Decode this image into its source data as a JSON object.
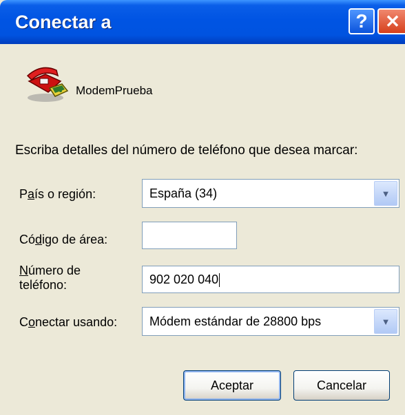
{
  "window": {
    "title": "Conectar a"
  },
  "titlebar_buttons": {
    "help": "?",
    "close": "✕"
  },
  "connection": {
    "name": "ModemPrueba",
    "icon": "phone-modem-icon"
  },
  "instructions": "Escriba detalles del número de teléfono que desea marcar:",
  "fields": {
    "country": {
      "label_prefix": "P",
      "label_accel": "a",
      "label_rest": "ís o región:",
      "value": "España (34)"
    },
    "area_code": {
      "label_prefix": "Có",
      "label_accel": "d",
      "label_rest": "igo de área:",
      "value": ""
    },
    "phone": {
      "label_line1_accel": "N",
      "label_line1_rest": "úmero de",
      "label_line2": "teléfono:",
      "value": "902 020 040"
    },
    "connect_using": {
      "label_prefix": "C",
      "label_accel": "o",
      "label_rest": "nectar usando:",
      "value": "Módem estándar de 28800 bps"
    }
  },
  "buttons": {
    "ok": "Aceptar",
    "cancel": "Cancelar"
  },
  "colors": {
    "titlebar": "#0054e3",
    "dialog_bg": "#ece9d8",
    "close": "#d6401c"
  }
}
